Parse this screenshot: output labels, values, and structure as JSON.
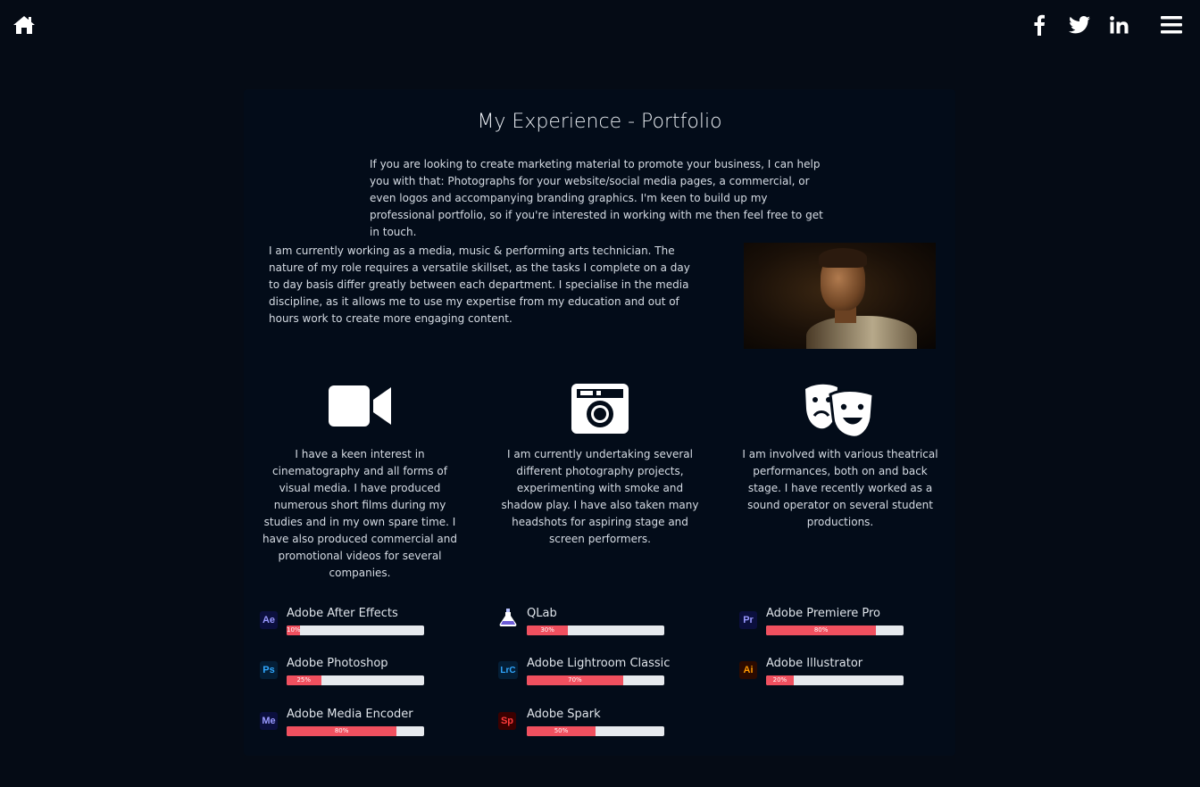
{
  "nav": {
    "home_icon": "home-icon",
    "social": [
      "facebook-icon",
      "twitter-icon",
      "linkedin-icon"
    ],
    "menu_icon": "hamburger-menu-icon"
  },
  "colors": {
    "background": "#050b15",
    "card": "#030c19",
    "accent": "#f0505f",
    "bar_track": "#e7eaee"
  },
  "main": {
    "title": "My Experience - Portfolio",
    "intro": "If you are looking to create marketing material to promote your business, I can help you with that: Photographs for your website/social media pages, a commercial, or even logos and accompanying branding graphics. I'm keen to build up my professional portfolio, so if you're interested in working with me then feel free to get in touch.",
    "about": "I am currently working as a media, music & performing arts technician. The nature of my role requires a versatile skillset, as the tasks I complete on a day to day basis differ greatly between each department. I specialise in the media discipline, as it allows me to use my expertise from my education and out of hours work to create more engaging content."
  },
  "features": [
    {
      "icon": "video-camera-icon",
      "text": "I have a keen interest in cinematography and all forms of visual media. I have produced numerous short films during my studies and in my own spare time. I have also produced commercial and promotional videos for several companies."
    },
    {
      "icon": "camera-icon",
      "text": "I am currently undertaking several different photography projects, experimenting with smoke and shadow play. I have also taken many headshots for aspiring stage and screen performers."
    },
    {
      "icon": "theater-masks-icon",
      "text": "I am involved with various theatrical performances, both on and back stage. I have recently worked as a sound operator on several student productions."
    }
  ],
  "skills": [
    {
      "abbr": "Ae",
      "name": "Adobe After Effects",
      "percent": 10,
      "label": "10%",
      "badge_bg": "#0b0f3d",
      "badge_fg": "#9999ff"
    },
    {
      "abbr": "",
      "name": "QLab",
      "percent": 30,
      "label": "30%",
      "icon": "qlab-icon"
    },
    {
      "abbr": "Pr",
      "name": "Adobe Premiere Pro",
      "percent": 80,
      "label": "80%",
      "badge_bg": "#0b0f3d",
      "badge_fg": "#9999ff"
    },
    {
      "abbr": "Ps",
      "name": "Adobe Photoshop",
      "percent": 25,
      "label": "25%",
      "badge_bg": "#041e36",
      "badge_fg": "#31a8ff"
    },
    {
      "abbr": "LrC",
      "name": "Adobe Lightroom Classic",
      "percent": 70,
      "label": "70%",
      "badge_bg": "#041e36",
      "badge_fg": "#31a8ff"
    },
    {
      "abbr": "Ai",
      "name": "Adobe Illustrator",
      "percent": 20,
      "label": "20%",
      "badge_bg": "#2b0a00",
      "badge_fg": "#ff9a00"
    },
    {
      "abbr": "Me",
      "name": "Adobe Media Encoder",
      "percent": 80,
      "label": "80%",
      "badge_bg": "#0b0f3d",
      "badge_fg": "#9999ff"
    },
    {
      "abbr": "Sp",
      "name": "Adobe Spark",
      "percent": 50,
      "label": "50%",
      "badge_bg": "#3a0000",
      "badge_fg": "#ff3b3b"
    }
  ]
}
